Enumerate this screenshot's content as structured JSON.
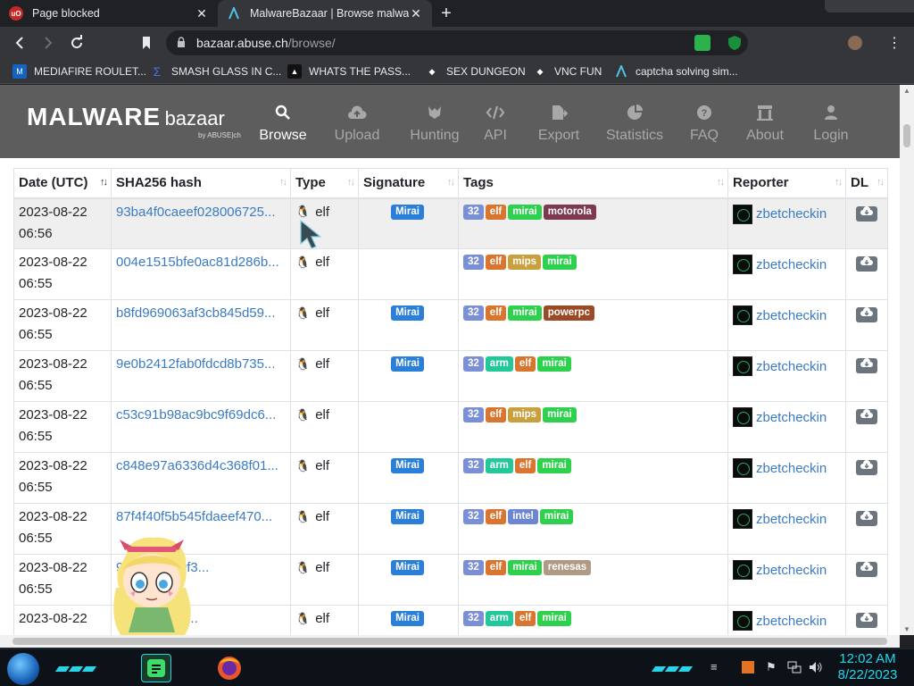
{
  "browser": {
    "tabs": [
      {
        "title": "Page blocked",
        "favicon": "ublock-icon",
        "active": false
      },
      {
        "title": "MalwareBazaar | Browse malware s",
        "favicon": "abuse-icon",
        "active": true
      }
    ],
    "close_glyph": "✕",
    "new_tab_glyph": "+",
    "url_host": "bazaar.abuse.ch",
    "url_path": "/browse/",
    "bookmarks": [
      {
        "label": "MEDIAFIRE ROULET...",
        "icon": "mediafire-icon"
      },
      {
        "label": "SMASH GLASS IN C...",
        "icon": "sigma-icon"
      },
      {
        "label": "WHATS THE PASS...",
        "icon": "mask-icon"
      },
      {
        "label": "SEX DUNGEON",
        "icon": "cube-icon"
      },
      {
        "label": "VNC FUN",
        "icon": "cube-icon"
      },
      {
        "label": "captcha solving sim...",
        "icon": "abuse-icon"
      }
    ]
  },
  "site": {
    "logo_main": "MALWARE",
    "logo_sub": "bazaar",
    "logo_by": "by ABUSE|ch",
    "nav": [
      {
        "label": "Browse",
        "icon": "search-icon",
        "active": true
      },
      {
        "label": "Upload",
        "icon": "cloud-upload-icon",
        "active": false
      },
      {
        "label": "Hunting",
        "icon": "hunting-icon",
        "active": false
      },
      {
        "label": "API",
        "icon": "code-icon",
        "active": false
      },
      {
        "label": "Export",
        "icon": "export-icon",
        "active": false
      },
      {
        "label": "Statistics",
        "icon": "pie-chart-icon",
        "active": false
      },
      {
        "label": "FAQ",
        "icon": "question-icon",
        "active": false
      },
      {
        "label": "About",
        "icon": "building-icon",
        "active": false
      },
      {
        "label": "Login",
        "icon": "user-icon",
        "active": false
      }
    ]
  },
  "table": {
    "headers": {
      "date": "Date (UTC)",
      "hash": "SHA256 hash",
      "type": "Type",
      "signature": "Signature",
      "tags": "Tags",
      "reporter": "Reporter",
      "dl": "DL"
    },
    "rows": [
      {
        "date": "2023-08-22",
        "time": "06:56",
        "hash": "93ba4f0caeef028006725...",
        "type": "elf",
        "signature": "Mirai",
        "tags": [
          "32",
          "elf",
          "mirai",
          "motorola"
        ],
        "reporter": "zbetcheckin"
      },
      {
        "date": "2023-08-22",
        "time": "06:55",
        "hash": "004e1515bfe0ac81d286b...",
        "type": "elf",
        "signature": "",
        "tags": [
          "32",
          "elf",
          "mips",
          "mirai"
        ],
        "reporter": "zbetcheckin"
      },
      {
        "date": "2023-08-22",
        "time": "06:55",
        "hash": "b8fd969063af3cb845d59...",
        "type": "elf",
        "signature": "Mirai",
        "tags": [
          "32",
          "elf",
          "mirai",
          "powerpc"
        ],
        "reporter": "zbetcheckin"
      },
      {
        "date": "2023-08-22",
        "time": "06:55",
        "hash": "9e0b2412fab0fdcd8b735...",
        "type": "elf",
        "signature": "Mirai",
        "tags": [
          "32",
          "arm",
          "elf",
          "mirai"
        ],
        "reporter": "zbetcheckin"
      },
      {
        "date": "2023-08-22",
        "time": "06:55",
        "hash": "c53c91b98ac9bc9f69dc6...",
        "type": "elf",
        "signature": "",
        "tags": [
          "32",
          "elf",
          "mips",
          "mirai"
        ],
        "reporter": "zbetcheckin"
      },
      {
        "date": "2023-08-22",
        "time": "06:55",
        "hash": "c848e97a6336d4c368f01...",
        "type": "elf",
        "signature": "Mirai",
        "tags": [
          "32",
          "arm",
          "elf",
          "mirai"
        ],
        "reporter": "zbetcheckin"
      },
      {
        "date": "2023-08-22",
        "time": "06:55",
        "hash": "87f4f40f5b545fdaeef470...",
        "type": "elf",
        "signature": "Mirai",
        "tags": [
          "32",
          "elf",
          "intel",
          "mirai"
        ],
        "reporter": "zbetcheckin"
      },
      {
        "date": "2023-08-22",
        "time": "06:55",
        "hash": "9af72053a0f3...",
        "type": "elf",
        "signature": "Mirai",
        "tags": [
          "32",
          "elf",
          "mirai",
          "renesas"
        ],
        "reporter": "zbetcheckin"
      },
      {
        "date": "2023-08-22",
        "time": "",
        "hash": "9d89f18017...",
        "type": "elf",
        "signature": "Mirai",
        "tags": [
          "32",
          "arm",
          "elf",
          "mirai"
        ],
        "reporter": "zbetcheckin"
      }
    ]
  },
  "tag_colors": {
    "32": "#7b8fd6",
    "elf": "#d9752e",
    "mirai": "#2ed14e",
    "mips": "#c9a03e",
    "arm": "#22c79a",
    "intel": "#6d86d4",
    "motorola": "#7d3a4e",
    "powerpc": "#9a4a24",
    "renesas": "#b09a86"
  },
  "signature_color": "#2a7fd9",
  "taskbar": {
    "time": "12:02 AM",
    "date": "8/22/2023"
  }
}
